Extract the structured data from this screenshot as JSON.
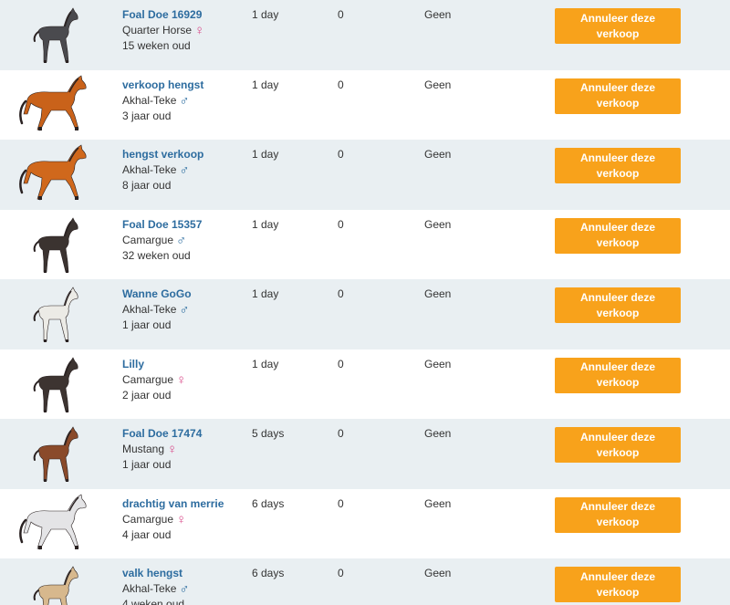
{
  "rows": [
    {
      "name": "Foal Doe 16929",
      "breed": "Quarter Horse",
      "gender": "female",
      "gender_symbol": "♀",
      "age": "15 weken oud",
      "time": "1 day",
      "bids": "0",
      "bidder": "Geen",
      "cancel_label": "Annuleer deze verkoop",
      "coat_color": "#4a4a4e",
      "shape": "foal"
    },
    {
      "name": "verkoop hengst",
      "breed": "Akhal-Teke",
      "gender": "male",
      "gender_symbol": "♂",
      "age": "3 jaar oud",
      "time": "1 day",
      "bids": "0",
      "bidder": "Geen",
      "cancel_label": "Annuleer deze verkoop",
      "coat_color": "#c9621a",
      "shape": "adult"
    },
    {
      "name": "hengst verkoop",
      "breed": "Akhal-Teke",
      "gender": "male",
      "gender_symbol": "♂",
      "age": "8 jaar oud",
      "time": "1 day",
      "bids": "0",
      "bidder": "Geen",
      "cancel_label": "Annuleer deze verkoop",
      "coat_color": "#d0681c",
      "shape": "adult"
    },
    {
      "name": "Foal Doe 15357",
      "breed": "Camargue",
      "gender": "male",
      "gender_symbol": "♂",
      "age": "32 weken oud",
      "time": "1 day",
      "bids": "0",
      "bidder": "Geen",
      "cancel_label": "Annuleer deze verkoop",
      "coat_color": "#3b3330",
      "shape": "foal"
    },
    {
      "name": "Wanne GoGo",
      "breed": "Akhal-Teke",
      "gender": "male",
      "gender_symbol": "♂",
      "age": "1 jaar oud",
      "time": "1 day",
      "bids": "0",
      "bidder": "Geen",
      "cancel_label": "Annuleer deze verkoop",
      "coat_color": "#ecebe6",
      "shape": "foal"
    },
    {
      "name": "Lilly",
      "breed": "Camargue",
      "gender": "female",
      "gender_symbol": "♀",
      "age": "2 jaar oud",
      "time": "1 day",
      "bids": "0",
      "bidder": "Geen",
      "cancel_label": "Annuleer deze verkoop",
      "coat_color": "#3d3431",
      "shape": "foal"
    },
    {
      "name": "Foal Doe 17474",
      "breed": "Mustang",
      "gender": "female",
      "gender_symbol": "♀",
      "age": "1 jaar oud",
      "time": "5 days",
      "bids": "0",
      "bidder": "Geen",
      "cancel_label": "Annuleer deze verkoop",
      "coat_color": "#8a4a2a",
      "shape": "foal"
    },
    {
      "name": "drachtig van merrie",
      "breed": "Camargue",
      "gender": "female",
      "gender_symbol": "♀",
      "age": "4 jaar oud",
      "time": "6 days",
      "bids": "0",
      "bidder": "Geen",
      "cancel_label": "Annuleer deze verkoop",
      "coat_color": "#e4e4e6",
      "shape": "adult"
    },
    {
      "name": "valk hengst",
      "breed": "Akhal-Teke",
      "gender": "male",
      "gender_symbol": "♂",
      "age": "4 weken oud",
      "time": "6 days",
      "bids": "0",
      "bidder": "Geen",
      "cancel_label": "Annuleer deze verkoop",
      "coat_color": "#d7b88d",
      "shape": "foal"
    }
  ]
}
